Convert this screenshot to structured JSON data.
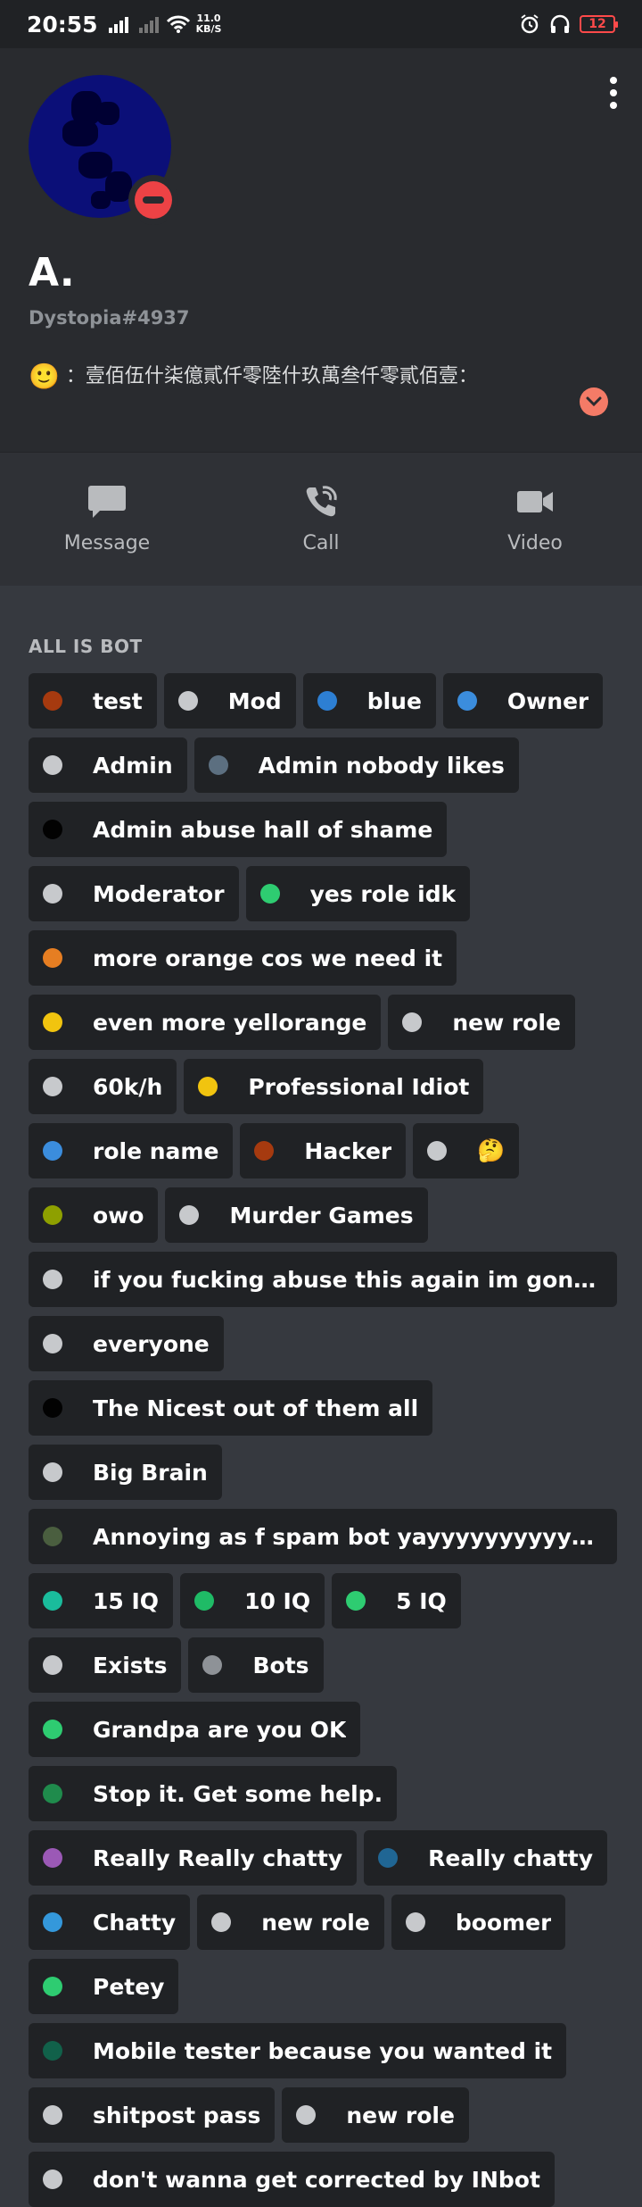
{
  "status_bar": {
    "time": "20:55",
    "net_speed_value": "11.0",
    "net_speed_unit": "KB/S",
    "battery": "12"
  },
  "profile": {
    "display_name": "A.",
    "tag": "Dystopia#4937",
    "status_emoji": "🙂",
    "custom_status": "：壹佰伍什柒億貳仟零陸什玖萬叁仟零貳佰壹："
  },
  "actions": [
    {
      "label": "Message"
    },
    {
      "label": "Call"
    },
    {
      "label": "Video"
    }
  ],
  "roles_title": "ALL IS BOT",
  "roles": [
    {
      "name": "test",
      "color": "#a63a0f"
    },
    {
      "name": "Mod",
      "color": "#c7c9cc"
    },
    {
      "name": "blue",
      "color": "#2d7fd3"
    },
    {
      "name": "Owner",
      "color": "#3b8ddd"
    },
    {
      "name": "Admin",
      "color": "#c7c9cc"
    },
    {
      "name": "Admin nobody likes",
      "color": "#5c6f80"
    },
    {
      "name": "Admin abuse hall of shame",
      "color": "#020202"
    },
    {
      "name": "Moderator",
      "color": "#c7c9cc"
    },
    {
      "name": "yes role idk",
      "color": "#2ecc71"
    },
    {
      "name": "more orange cos we need it",
      "color": "#e67e22"
    },
    {
      "name": "even more yellorange",
      "color": "#f1c40f"
    },
    {
      "name": "new role",
      "color": "#c7c9cc"
    },
    {
      "name": "60k/h",
      "color": "#c7c9cc"
    },
    {
      "name": "Professional Idiot",
      "color": "#f1c40f"
    },
    {
      "name": "role name",
      "color": "#3b8ddd"
    },
    {
      "name": "Hacker",
      "color": "#a63a0f"
    },
    {
      "name": "🤔",
      "color": "#c7c9cc"
    },
    {
      "name": "owo",
      "color": "#8ea000"
    },
    {
      "name": "Murder Games",
      "color": "#c7c9cc"
    },
    {
      "name": "if you fucking abuse this again im gonna nuke ...",
      "color": "#c7c9cc"
    },
    {
      "name": "everyone",
      "color": "#c7c9cc"
    },
    {
      "name": "The Nicest out of them all",
      "color": "#020202"
    },
    {
      "name": "Big Brain",
      "color": "#c7c9cc"
    },
    {
      "name": "Annoying as f spam bot yayyyyyyyyyyyyyyyy",
      "color": "#4a5e3f"
    },
    {
      "name": "15 IQ",
      "color": "#1abc9c"
    },
    {
      "name": "10 IQ",
      "color": "#1fbb66"
    },
    {
      "name": "5 IQ",
      "color": "#2ecc71"
    },
    {
      "name": "Exists",
      "color": "#c7c9cc"
    },
    {
      "name": "Bots",
      "color": "#8e9297"
    },
    {
      "name": "Grandpa are you OK",
      "color": "#2ecc71"
    },
    {
      "name": "Stop it. Get some help.",
      "color": "#1f8b4c"
    },
    {
      "name": "Really Really chatty",
      "color": "#9b59b6"
    },
    {
      "name": "Really chatty",
      "color": "#206694"
    },
    {
      "name": "Chatty",
      "color": "#3498db"
    },
    {
      "name": "new role",
      "color": "#c7c9cc"
    },
    {
      "name": "boomer",
      "color": "#c7c9cc"
    },
    {
      "name": "Petey",
      "color": "#2ecc71"
    },
    {
      "name": "Mobile tester because you wanted it",
      "color": "#11614a"
    },
    {
      "name": "shitpost pass",
      "color": "#c7c9cc"
    },
    {
      "name": "new role",
      "color": "#c7c9cc"
    },
    {
      "name": "don't wanna get corrected by INbot",
      "color": "#c7c9cc"
    }
  ]
}
